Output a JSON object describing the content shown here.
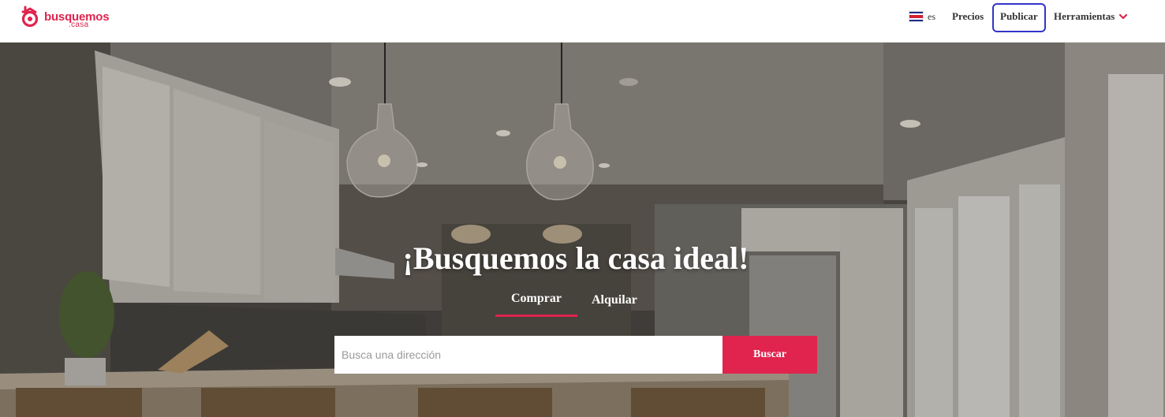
{
  "brand": {
    "name": "busquemos",
    "sub": ".casa",
    "color": "#e0244e",
    "logo_icon": "busquemos-logo-icon"
  },
  "nav": {
    "language": {
      "label": "es",
      "flag_icon": "costa-rica-flag-icon"
    },
    "precios": "Precios",
    "publicar": "Publicar",
    "herramientas": "Herramientas",
    "herramientas_icon": "chevron-down-icon",
    "highlight_color": "#3434c8"
  },
  "hero": {
    "title": "¡Busquemos la casa ideal!",
    "tabs": [
      {
        "label": "Comprar",
        "active": true
      },
      {
        "label": "Alquilar",
        "active": false
      }
    ],
    "search": {
      "placeholder": "Busca una dirección",
      "value": "",
      "button": "Buscar"
    },
    "background": "kitchen-interior-photo"
  }
}
